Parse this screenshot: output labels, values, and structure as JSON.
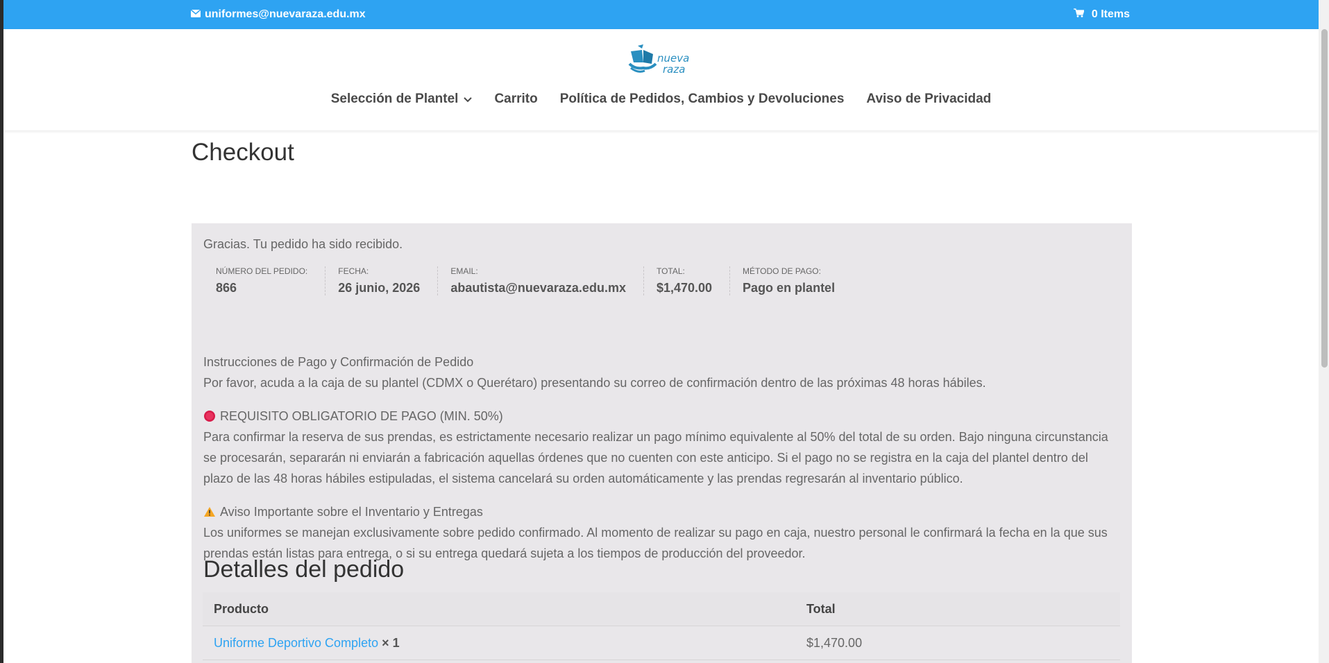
{
  "topbar": {
    "email": "uniformes@nuevaraza.edu.mx",
    "cart": "0 Items"
  },
  "logo": {
    "line1": "nueva",
    "line2": "raza"
  },
  "nav": {
    "items": [
      {
        "label": "Selección de Plantel",
        "has_dropdown": true
      },
      {
        "label": "Carrito"
      },
      {
        "label": "Política de Pedidos, Cambios y Devoluciones"
      },
      {
        "label": "Aviso de Privacidad"
      }
    ]
  },
  "page": {
    "title": "Checkout"
  },
  "order": {
    "thanks": "Gracias. Tu pedido ha sido recibido.",
    "overview": [
      {
        "label": "Número del pedido:",
        "value": "866"
      },
      {
        "label": "Fecha:",
        "value": "26 junio, 2026"
      },
      {
        "label": "Email:",
        "value": "abautista@nuevaraza.edu.mx"
      },
      {
        "label": "Total:",
        "value": "$1,470.00"
      },
      {
        "label": "Método de pago:",
        "value": "Pago en plantel"
      }
    ],
    "instructions": {
      "heading": "Instrucciones de Pago y Confirmación de Pedido",
      "text": "Por favor, acuda a la caja de su plantel (CDMX o Querétaro) presentando su correo de confirmación dentro de las próximas 48 horas hábiles.",
      "requirement_heading": "REQUISITO OBLIGATORIO DE PAGO (MIN. 50%)",
      "requirement_text": "Para confirmar la reserva de sus prendas, es estrictamente necesario realizar un pago mínimo equivalente al 50% del total de su orden. Bajo ninguna circunstancia se procesarán, separarán ni enviarán a fabricación aquellas órdenes que no cuenten con este anticipo. Si el pago no se registra en la caja del plantel dentro del plazo de las 48 horas hábiles estipuladas, el sistema cancelará su orden automáticamente y las prendas regresarán al inventario público.",
      "notice_heading": "Aviso Importante sobre el Inventario y Entregas",
      "notice_text": "Los uniformes se manejan exclusivamente sobre pedido confirmado. Al momento de realizar su pago en caja, nuestro personal le confirmará la fecha en la que sus prendas están listas para entrega, o si su entrega quedará sujeta a los tiempos de producción del proveedor."
    },
    "details": {
      "title": "Detalles del pedido",
      "col_product": "Producto",
      "col_total": "Total",
      "rows": [
        {
          "product": "Uniforme Deportivo Completo",
          "qty": "× 1",
          "total": "$1,470.00"
        }
      ]
    }
  },
  "colors": {
    "accent": "#2ea3f2",
    "box_bg": "#e9e7ea",
    "logo": "#2a8fc0"
  }
}
